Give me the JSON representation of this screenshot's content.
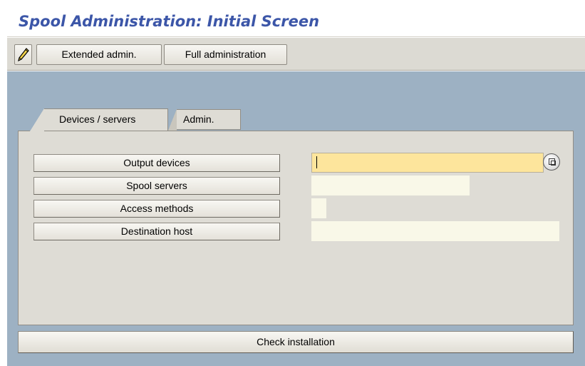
{
  "title": "Spool Administration: Initial Screen",
  "toolbar": {
    "edit_icon": "pencil-icon",
    "extended_admin_label": "Extended admin.",
    "full_admin_label": "Full administration"
  },
  "tabs": [
    {
      "label": "Devices / servers",
      "active": true
    },
    {
      "label": "Admin.",
      "active": false
    }
  ],
  "rows": [
    {
      "button_label": "Output devices",
      "field_value": ""
    },
    {
      "button_label": "Spool servers",
      "field_value": ""
    },
    {
      "button_label": "Access methods",
      "field_value": ""
    },
    {
      "button_label": "Destination host",
      "field_value": ""
    }
  ],
  "value_help_icon": "possible-entries-icon",
  "check_installation_label": "Check installation",
  "colors": {
    "title": "#3c56a8",
    "background": "#9db1c3",
    "panel": "#dedcd5",
    "active_field": "#fde59c",
    "input_field": "#f9f8e8"
  }
}
